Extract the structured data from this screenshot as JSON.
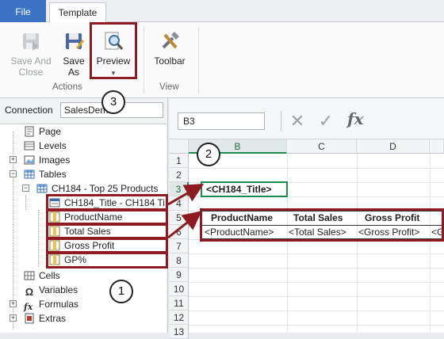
{
  "tabs": {
    "file": "File",
    "template": "Template"
  },
  "ribbon": {
    "save_and_close": "Save And\nClose",
    "save_as": "Save\nAs",
    "preview": "Preview",
    "toolbar": "Toolbar",
    "group_actions": "Actions",
    "group_view": "View"
  },
  "connection": {
    "label": "Connection",
    "value": "SalesDem"
  },
  "tree": {
    "page": "Page",
    "levels": "Levels",
    "images": "Images",
    "tables": "Tables",
    "table_name": "CH184 - Top 25 Products",
    "fields": [
      "CH184_Title - CH184 Ti",
      "ProductName",
      "Total Sales",
      "Gross Profit",
      "GP%"
    ],
    "cells": "Cells",
    "variables": "Variables",
    "formulas": "Formulas",
    "extras": "Extras"
  },
  "formula_bar": {
    "name_box": "B3",
    "cancel_icon": "✕",
    "enter_icon": "✓",
    "fx": "fx"
  },
  "grid": {
    "columns": [
      "B",
      "C",
      "D"
    ],
    "rows": [
      "1",
      "2",
      "3",
      "4",
      "5",
      "6",
      "7",
      "8",
      "9",
      "10",
      "11",
      "12",
      "13"
    ],
    "title_cell": "<CH184_Title>",
    "headers": [
      "ProductName",
      "Total Sales",
      "Gross Profit"
    ],
    "placeholders": [
      "<ProductName>",
      "<Total Sales>",
      "<Gross Profit>",
      "<G"
    ]
  },
  "callouts": {
    "one": "1",
    "two": "2",
    "three": "3"
  },
  "colors": {
    "file_tab": "#3c73c2",
    "highlight": "#8e1b21",
    "selection": "#1e8c4e"
  }
}
